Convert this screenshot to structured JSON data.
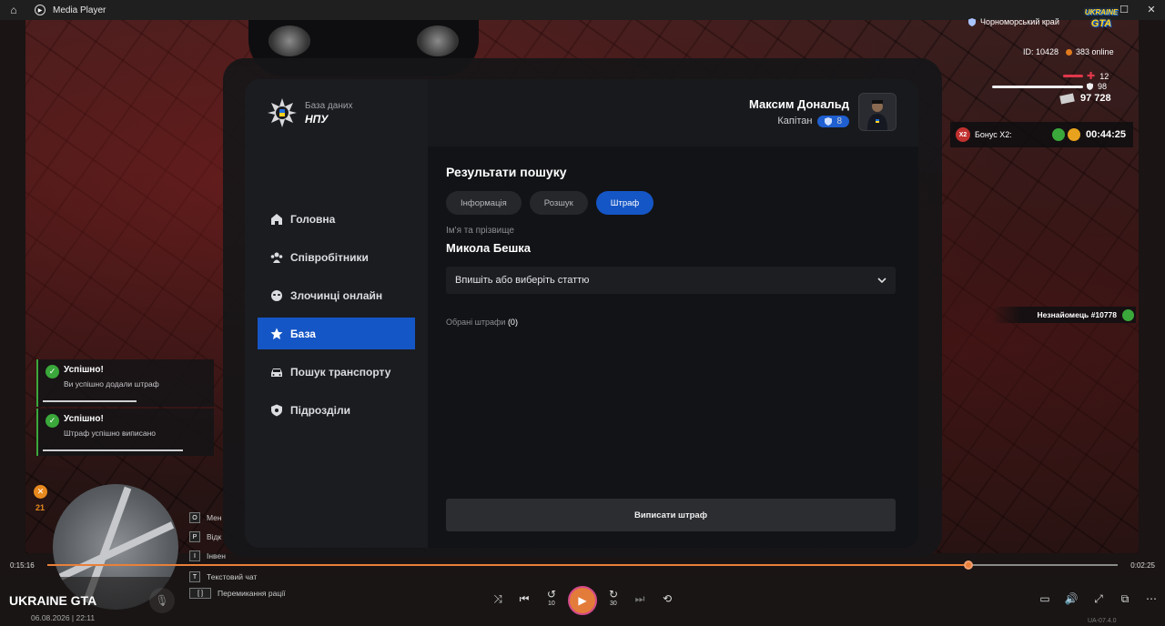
{
  "titlebar": {
    "home_icon": "home-icon",
    "app_icon": "media-player-icon",
    "title": "Media Player"
  },
  "modal": {
    "logo_sub": "База даних",
    "logo_main": "НПУ",
    "nav": [
      {
        "label": "Головна",
        "icon": "home-icon",
        "active": false
      },
      {
        "label": "Співробітники",
        "icon": "users-icon",
        "active": false
      },
      {
        "label": "Злочинці онлайн",
        "icon": "mask-icon",
        "active": false
      },
      {
        "label": "База",
        "icon": "star-icon",
        "active": true
      },
      {
        "label": "Пошук транспорту",
        "icon": "car-icon",
        "active": false
      },
      {
        "label": "Підрозділи",
        "icon": "shield-icon",
        "active": false
      }
    ],
    "profile": {
      "name": "Максим Дональд",
      "rank": "Капітан",
      "rank_level": "8"
    },
    "results_title": "Результати пошуку",
    "tabs": [
      {
        "label": "Інформація",
        "active": false
      },
      {
        "label": "Розшук",
        "active": false
      },
      {
        "label": "Штраф",
        "active": true
      }
    ],
    "field_label": "Ім'я та прізвище",
    "field_value": "Микола Бешка",
    "select_placeholder": "Впишіть або виберіть статтю",
    "selected_fines_label": "Обрані штрафи",
    "selected_fines_count": "(0)",
    "submit_label": "Виписати штраф"
  },
  "hud": {
    "region": "Чорноморський край",
    "logo_line1": "UKRAINE",
    "logo_line2": "GTA",
    "id": "ID: 10428",
    "online": "383 online",
    "health": "12",
    "armor": "98",
    "money": "97 728",
    "bonus_label": "Бонус X2:",
    "bonus_x2": "X2",
    "bonus_timer": "00:44:25",
    "stranger": "Незнайомець #10778",
    "wanted_level": "21"
  },
  "notifications": [
    {
      "title": "Успішно!",
      "text": "Ви успішно додали штраф",
      "progress": 0.55
    },
    {
      "title": "Успішно!",
      "text": "Штраф успішно виписано",
      "progress": 0.8
    }
  ],
  "hints": [
    {
      "key": "O",
      "label": "Мен"
    },
    {
      "key": "P",
      "label": "Відк"
    },
    {
      "key": "I",
      "label": "Інвен"
    },
    {
      "key": "T",
      "label": "Текстовий чат"
    },
    {
      "key": "[ ]",
      "label": "Перемикання рації"
    }
  ],
  "player": {
    "time_current": "0:15:16",
    "time_remaining": "0:02:25",
    "progress": 0.865,
    "media_title": "UKRAINE GTA",
    "media_date": "06.08.2026 | 22:11",
    "skip_back": "10",
    "skip_forward": "30",
    "version": "UA-07.4.0"
  }
}
